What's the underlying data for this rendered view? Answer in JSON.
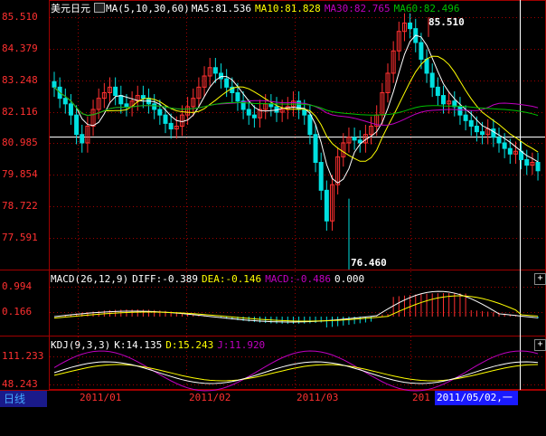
{
  "main": {
    "title": "美元日元",
    "ma_icon": "ma-indicator-icon",
    "ma_params": "MA(5,10,30,60)",
    "ma5": "MA5:81.536",
    "ma10": "MA10:81.828",
    "ma30": "MA30:82.765",
    "ma60": "MA60:82.496",
    "y_labels": [
      "85.510",
      "84.379",
      "83.248",
      "82.116",
      "80.985",
      "79.854",
      "78.722",
      "77.591"
    ],
    "high_tag": "85.510",
    "low_tag": "76.460",
    "colors": {
      "up": "#ff3030",
      "down": "#00e0e0",
      "ma5": "#ffffff",
      "ma10": "#ffff00",
      "ma30": "#c000c0",
      "ma60": "#00c000"
    }
  },
  "macd": {
    "label": "MACD(26,12,9)",
    "diff": "DIFF:-0.389",
    "dea": "DEA:-0.146",
    "macd": "MACD:-0.486",
    "extra": "0.000",
    "y_labels": [
      "0.994",
      "0.166"
    ]
  },
  "kdj": {
    "label": "KDJ(9,3,3)",
    "k": "K:14.135",
    "d": "D:15.243",
    "j": "J:11.920",
    "y_labels": [
      "111.233",
      "48.243"
    ]
  },
  "footer": {
    "period_tab": "日线",
    "dates": [
      "2011/01",
      "2011/02",
      "2011/03",
      "201"
    ],
    "cursor_date": "2011/05/02,一"
  },
  "panel_buttons": [
    "+",
    "+"
  ]
}
